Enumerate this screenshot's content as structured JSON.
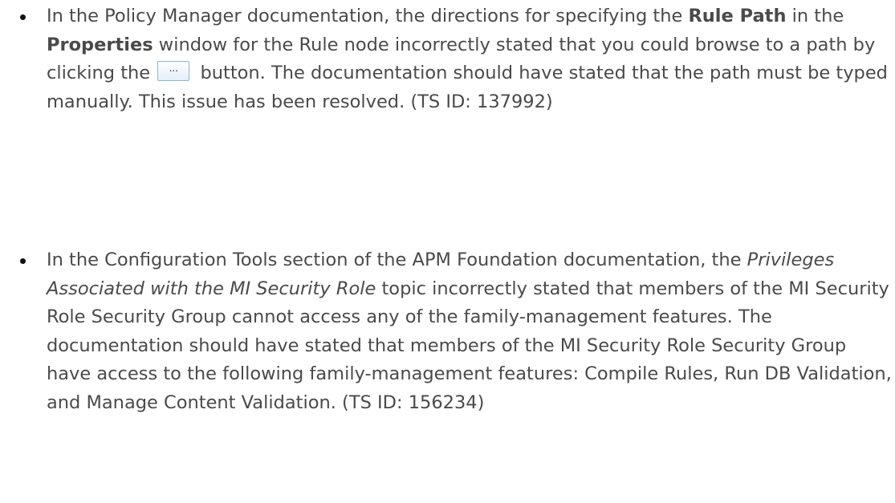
{
  "items": [
    {
      "segments": [
        {
          "text": "In the Policy Manager documentation, the directions for specifying the ",
          "style": "normal"
        },
        {
          "text": "Rule Path",
          "style": "bold"
        },
        {
          "text": " in the ",
          "style": "normal"
        },
        {
          "text": "Properties",
          "style": "bold"
        },
        {
          "text": " window for the Rule node incorrectly stated that you could browse to a path by clicking the",
          "style": "normal"
        },
        {
          "text": "button. The documentation should have stated that the path must be typed manually. This issue has been resolved. (TS ID: 137992)",
          "style": "normal"
        }
      ],
      "inline_button": {
        "label": "...",
        "icon": "ellipsis-browse-icon"
      }
    },
    {
      "segments": [
        {
          "text": "In the Configuration Tools section of the APM Foundation documentation, the ",
          "style": "normal"
        },
        {
          "text": "Privileges Associated with the MI Security Role",
          "style": "italic"
        },
        {
          "text": " topic incorrectly stated that members of the MI Security Role Security Group cannot access any of the family-management features.  The documentation should have stated that members of the MI Security Role Security Group have access to the following family-management features: Compile Rules, Run DB Validation, and Manage Content Validation. (TS ID: 156234)",
          "style": "normal"
        }
      ]
    }
  ]
}
